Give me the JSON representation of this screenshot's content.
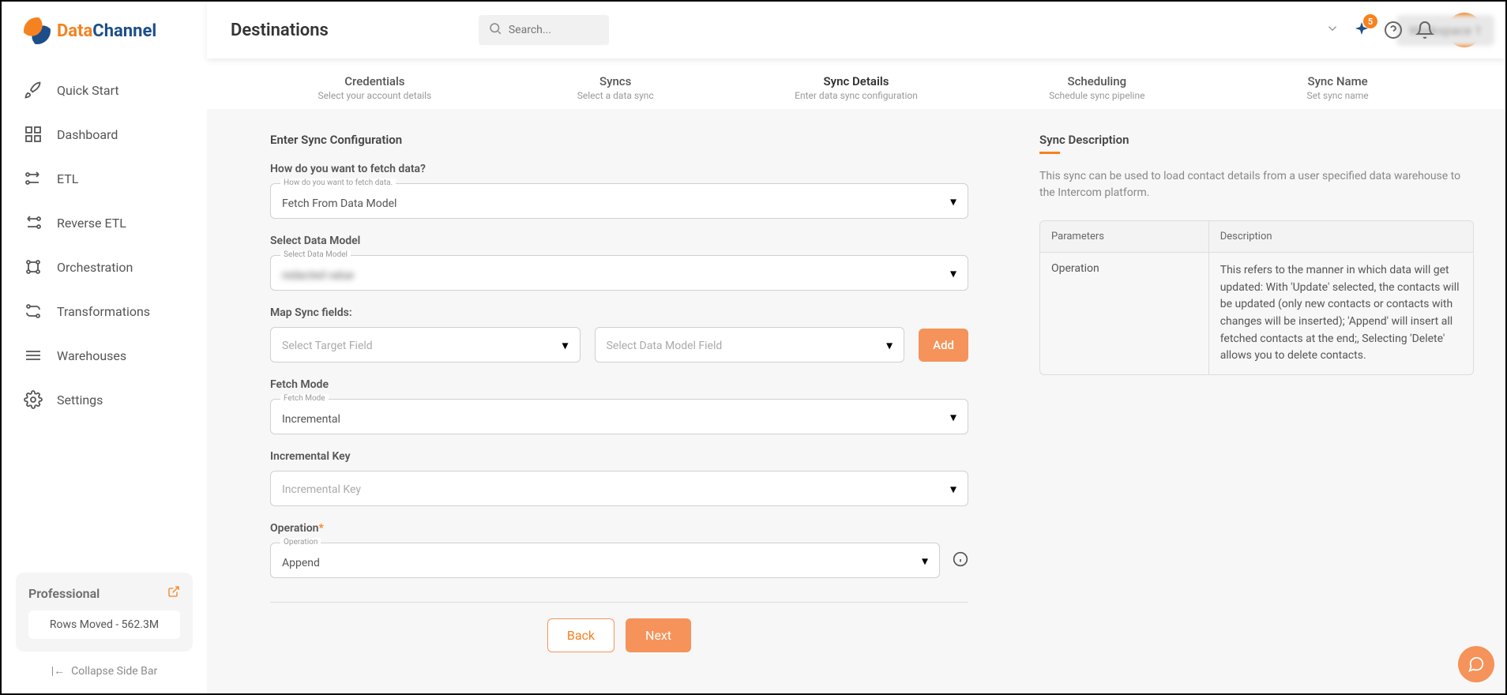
{
  "logo": {
    "text1": "Data",
    "text2": "Channel"
  },
  "nav": [
    {
      "label": "Quick Start",
      "name": "quick-start"
    },
    {
      "label": "Dashboard",
      "name": "dashboard"
    },
    {
      "label": "ETL",
      "name": "etl"
    },
    {
      "label": "Reverse ETL",
      "name": "reverse-etl"
    },
    {
      "label": "Orchestration",
      "name": "orchestration"
    },
    {
      "label": "Transformations",
      "name": "transformations"
    },
    {
      "label": "Warehouses",
      "name": "warehouses"
    },
    {
      "label": "Settings",
      "name": "settings"
    }
  ],
  "plan": {
    "title": "Professional",
    "stat": "Rows Moved - 562.3M"
  },
  "collapse": "Collapse Side Bar",
  "header": {
    "title": "Destinations",
    "search_placeholder": "Search...",
    "workspace": "Workspace 1",
    "badge": "5",
    "avatar": "D"
  },
  "steps": [
    {
      "title": "Credentials",
      "sub": "Select your account details"
    },
    {
      "title": "Syncs",
      "sub": "Select a data sync"
    },
    {
      "title": "Sync Details",
      "sub": "Enter data sync configuration"
    },
    {
      "title": "Scheduling",
      "sub": "Schedule sync pipeline"
    },
    {
      "title": "Sync Name",
      "sub": "Set sync name"
    }
  ],
  "form": {
    "section": "Enter Sync Configuration",
    "fetch_q": "How do you want to fetch data?",
    "fetch_float": "How do you want to fetch data.",
    "fetch_value": "Fetch From Data Model",
    "model_label": "Select Data Model",
    "model_float": "Select Data Model",
    "model_value": "redacted value",
    "map_label": "Map Sync fields:",
    "target_placeholder": "Select Target Field",
    "dmfield_placeholder": "Select Data Model Field",
    "add": "Add",
    "fetch_mode_label": "Fetch Mode",
    "fetch_mode_float": "Fetch Mode",
    "fetch_mode_value": "Incremental",
    "inc_key_label": "Incremental Key",
    "inc_key_placeholder": "Incremental Key",
    "operation_label": "Operation",
    "operation_float": "Operation",
    "operation_value": "Append",
    "back": "Back",
    "next": "Next"
  },
  "desc": {
    "title": "Sync Description",
    "text": "This sync can be used to load contact details from a user specified data warehouse to the Intercom platform.",
    "hdr1": "Parameters",
    "hdr2": "Description",
    "row_param": "Operation",
    "row_desc": "This refers to the manner in which data will get updated: With 'Update' selected, the contacts will be updated (only new contacts or contacts with changes will be inserted); 'Append' will insert all fetched contacts at the end;, Selecting 'Delete' allows you to delete contacts."
  }
}
